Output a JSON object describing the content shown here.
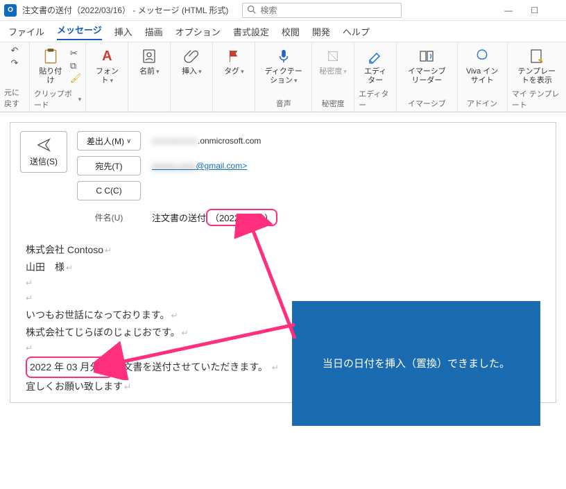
{
  "titlebar": {
    "title": "注文書の送付（2022/03/16）   - メッセージ (HTML 形式)",
    "search_placeholder": "検索"
  },
  "winctrls": {
    "min": "—",
    "max": "☐",
    "close": ""
  },
  "menubar": {
    "file": "ファイル",
    "message": "メッセージ",
    "insert": "挿入",
    "draw": "描画",
    "options": "オプション",
    "format": "書式設定",
    "review": "校閲",
    "developer": "開発",
    "help": "ヘルプ"
  },
  "ribbon": {
    "undo": {
      "label": "元に戻す"
    },
    "clipboard": {
      "paste": "貼り付け",
      "group": "クリップボード"
    },
    "font": {
      "btn": "フォント"
    },
    "names": {
      "btn": "名前"
    },
    "insert": {
      "btn": "挿入"
    },
    "tags": {
      "btn": "タグ"
    },
    "dictate": {
      "btn": "ディクテーション",
      "group": "音声"
    },
    "sensitivity": {
      "btn": "秘密度",
      "group": "秘密度"
    },
    "editor": {
      "btn": "エディター",
      "group": "エディター"
    },
    "immersive": {
      "btn": "イマーシブ リーダー",
      "group": "イマーシブ"
    },
    "viva": {
      "btn": "Viva インサイト",
      "group": "アドイン"
    },
    "template": {
      "btn": "テンプレートを表示",
      "group": "マイ テンプレート"
    }
  },
  "compose": {
    "send": "送信(S)",
    "from_btn": "差出人(M)",
    "from_val_masked": "xxxxxxxxxxx",
    "from_val_suffix": ".onmicrosoft.com",
    "to_btn": "宛先(T)",
    "to_val_masked": "xxxxxx xxxx",
    "to_val_suffix": "@gmail.com>",
    "cc_btn": "C C(C)",
    "subject_label": "件名(U)",
    "subject_prefix": "注文書の送付",
    "subject_highlight": "（2022/03/16）"
  },
  "body": {
    "l1": "株式会社 Contoso",
    "l2": "山田　様",
    "l3": "いつもお世話になっております。",
    "l4": "株式会社てじらぼのじょじおです。",
    "l5_hl": "2022 年 03 月分の",
    "l5_rest": "注文書を送付させていただきます。",
    "l6": "宜しくお願い致します"
  },
  "callout": {
    "text": "当日の日付を挿入（置換）できました。"
  }
}
